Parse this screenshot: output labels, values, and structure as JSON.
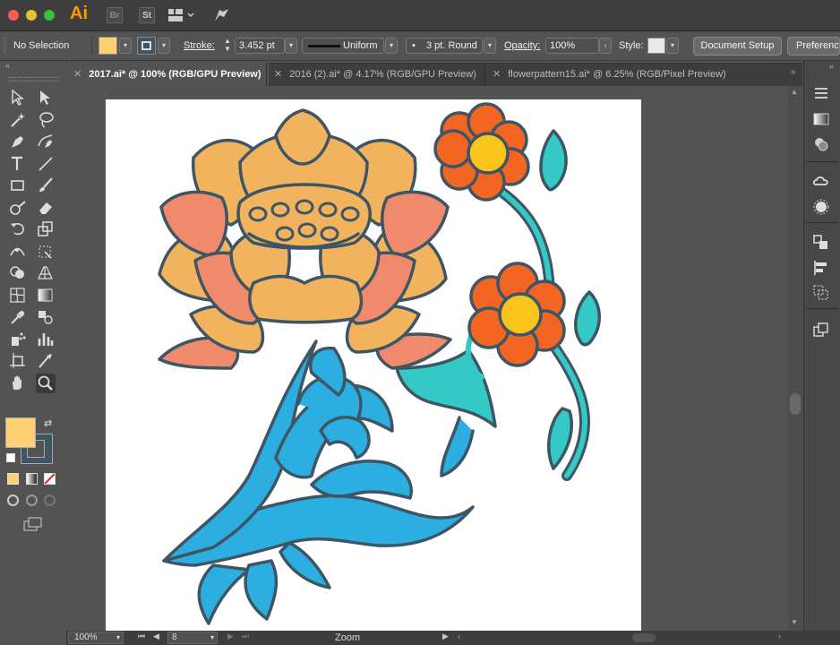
{
  "app": {
    "logo": "Ai",
    "bridge_label": "Br",
    "stock_label": "St"
  },
  "controlbar": {
    "selection_status": "No Selection",
    "fill_color": "#ffd173",
    "stroke_label": "Stroke:",
    "stroke_weight": "3.452 pt",
    "stroke_profile": "Uniform",
    "brush": "3 pt. Round",
    "opacity_label": "Opacity:",
    "opacity_value": "100%",
    "style_label": "Style:",
    "document_setup_label": "Document Setup",
    "preferences_label": "Preferences"
  },
  "tabs": [
    {
      "label": "2017.ai* @ 100% (RGB/GPU Preview)",
      "active": true
    },
    {
      "label": "2016 (2).ai* @ 4.17% (RGB/GPU Preview)",
      "active": false
    },
    {
      "label": "flowerpattern15.ai* @ 6.25% (RGB/Pixel Preview)",
      "active": false
    }
  ],
  "tools": [
    "selection-tool",
    "direct-selection-tool",
    "magic-wand-tool",
    "lasso-tool",
    "pen-tool",
    "curvature-tool",
    "type-tool",
    "line-segment-tool",
    "rectangle-tool",
    "paintbrush-tool",
    "shaper-tool",
    "eraser-tool",
    "rotate-tool",
    "scale-tool",
    "width-tool",
    "free-transform-tool",
    "shape-builder-tool",
    "perspective-grid-tool",
    "mesh-tool",
    "gradient-tool",
    "eyedropper-tool",
    "blend-tool",
    "symbol-sprayer-tool",
    "column-graph-tool",
    "artboard-tool",
    "slice-tool",
    "hand-tool",
    "zoom-tool"
  ],
  "fill_stroke": {
    "fill": "#ffd173",
    "stroke": "#3a3a3a"
  },
  "right_panel_icons": [
    "properties-icon",
    "gradient-panel-icon",
    "color-panel-icon",
    "cc-libraries-icon",
    "appearance-icon",
    "transform-icon",
    "align-icon",
    "pathfinder-icon",
    "artboards-icon"
  ],
  "status": {
    "zoom": "100%",
    "artboard_number": "8",
    "tool_name": "Zoom"
  },
  "colors": {
    "outline": "#3e5565",
    "lotus_orange": "#f2b35e",
    "lotus_salmon": "#ef8a6c",
    "flower_red": "#f26522",
    "flower_center": "#f9c41b",
    "teal": "#34c9c4",
    "blue": "#2caee0"
  }
}
